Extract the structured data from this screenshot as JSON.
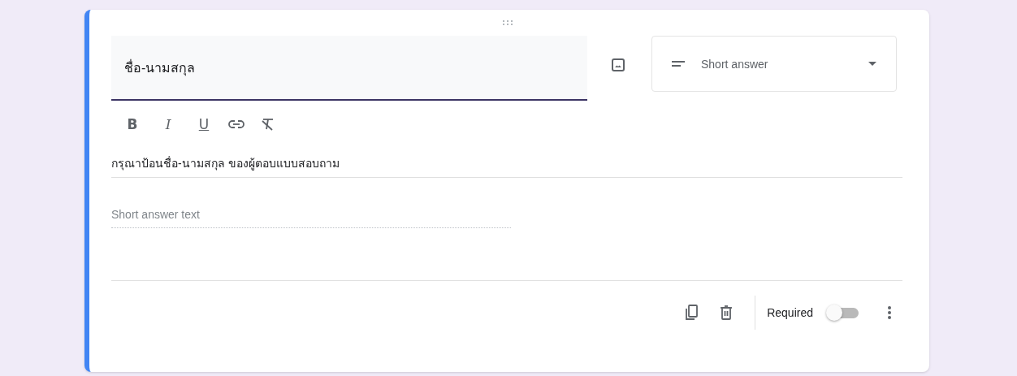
{
  "question": {
    "title": "ชื่อ-นามสกุล",
    "description": "กรุณาป้อนชื่อ-นามสกุล ของผู้ตอบแบบสอบถาม",
    "answer_placeholder": "Short answer text"
  },
  "toolbar": [
    {
      "kind": "bold",
      "label": "B"
    },
    {
      "kind": "italic",
      "label": "I"
    },
    {
      "kind": "underline",
      "label": "U"
    },
    {
      "kind": "link"
    },
    {
      "kind": "clear"
    }
  ],
  "type_dropdown": {
    "label": "Short answer"
  },
  "footer": {
    "required_label": "Required",
    "required_on": false
  }
}
